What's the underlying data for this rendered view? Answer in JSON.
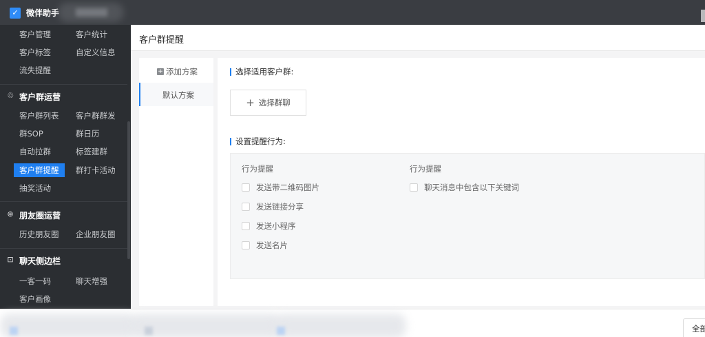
{
  "app": {
    "brand": "微伴助手"
  },
  "sidebar": {
    "rows": [
      {
        "c1": "客户管理",
        "c2": "客户统计"
      },
      {
        "c1": "客户标签",
        "c2": "自定义信息"
      },
      {
        "c1": "流失提醒",
        "c2": ""
      }
    ],
    "groups": [
      {
        "title": "客户群运营",
        "icon": "group-operation-icon",
        "rows": [
          {
            "c1": "客户群列表",
            "c2": "客户群群发"
          },
          {
            "c1": "群SOP",
            "c2": "群日历"
          },
          {
            "c1": "自动拉群",
            "c2": "标签建群"
          },
          {
            "c1": "客户群提醒",
            "c2": "群打卡活动",
            "active": true
          },
          {
            "c1": "抽奖活动",
            "c2": ""
          }
        ]
      },
      {
        "title": "朋友圈运营",
        "icon": "moments-icon",
        "rows": [
          {
            "c1": "历史朋友圈",
            "c2": "企业朋友圈"
          }
        ]
      },
      {
        "title": "聊天侧边栏",
        "icon": "chat-sidebar-icon",
        "rows": [
          {
            "c1": "一客一码",
            "c2": "聊天增强"
          },
          {
            "c1": "客户画像",
            "c2": ""
          }
        ]
      }
    ]
  },
  "header": {
    "title": "客户群提醒"
  },
  "plans": {
    "add_label": "添加方案",
    "items": [
      "默认方案"
    ]
  },
  "main": {
    "select_group_label": "选择适用客户群:",
    "select_group_button": "选择群聊",
    "behavior_label": "设置提醒行为:",
    "col1_head": "行为提醒",
    "col2_head": "行为提醒",
    "col1_options": [
      "发送带二维码图片",
      "发送链接分享",
      "发送小程序",
      "发送名片"
    ],
    "col2_options": [
      "聊天消息中包含以下关键词"
    ]
  },
  "footer": {
    "all_button": "全部"
  },
  "colors": {
    "accent": "#1f7ff0",
    "sidebar_bg": "#2b2e32",
    "topbar_bg": "#3a3d42"
  }
}
